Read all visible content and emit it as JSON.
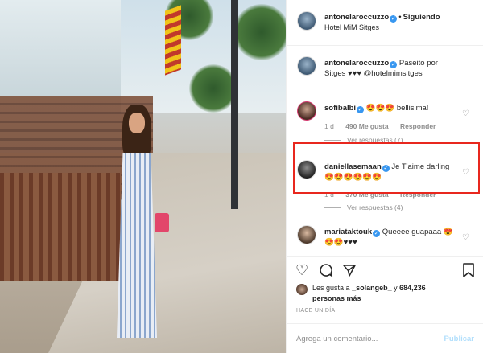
{
  "header": {
    "username": "antonelaroccuzzo",
    "follow_status": "Siguiendo",
    "location": "Hotel MiM Sitges"
  },
  "comments": [
    {
      "username": "antonelaroccuzzo",
      "text": "Paseito por Sitges ♥♥♥ @hotelmimsitges"
    },
    {
      "username": "sofibalbi",
      "text": "😍😍😍 bellisima!",
      "age": "1 d",
      "likes": "490 Me gusta",
      "reply": "Responder",
      "replies": "Ver respuestas (7)"
    },
    {
      "username": "daniellasemaan",
      "text": "Je T'aime darling 😍😍😍😍😍😍",
      "age": "1 d",
      "likes": "370 Me gusta",
      "reply": "Responder",
      "replies": "Ver respuestas (4)"
    },
    {
      "username": "mariataktouk",
      "text": "Queeee guapaaa 😍😍😍♥♥♥"
    }
  ],
  "likes_summary": {
    "prefix": "Les gusta a",
    "user": "_solangeb_",
    "connector": "y",
    "count": "684,236 personas más"
  },
  "timestamp": "HACE UN DÍA",
  "comment_box": {
    "placeholder": "Agrega un comentario...",
    "publish": "Publicar"
  },
  "icons": {
    "verified": "verified-badge-icon",
    "heart": "heart-icon",
    "comment": "comment-icon",
    "share": "share-icon",
    "save": "bookmark-icon"
  },
  "colors": {
    "verified": "#3897f0",
    "highlight": "#e8271e",
    "muted": "#8e8e8e",
    "publish": "#b2dffc"
  }
}
